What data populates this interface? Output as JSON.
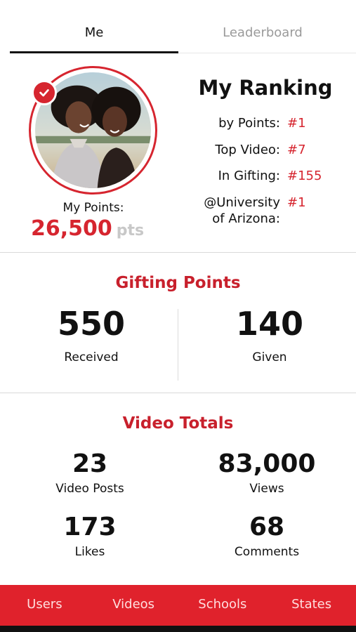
{
  "tabs": [
    {
      "label": "Me",
      "active": true
    },
    {
      "label": "Leaderboard",
      "active": false
    }
  ],
  "profile": {
    "points_label": "My Points:",
    "points_value": "26,500",
    "points_unit": "pts"
  },
  "ranking": {
    "title": "My Ranking",
    "rows": [
      {
        "label": "by Points:",
        "value": "#1"
      },
      {
        "label": "Top Video:",
        "value": "#7"
      },
      {
        "label": "In Gifting:",
        "value": "#155"
      },
      {
        "label": "@University of Arizona:",
        "label_line1": "@University",
        "label_line2": "of Arizona:",
        "value": "#1"
      }
    ]
  },
  "gifting": {
    "title": "Gifting Points",
    "received_value": "550",
    "received_label": "Received",
    "given_value": "140",
    "given_label": "Given"
  },
  "video_totals": {
    "title": "Video Totals",
    "stats": [
      {
        "value": "23",
        "label": "Video Posts"
      },
      {
        "value": "83,000",
        "label": "Views"
      },
      {
        "value": "173",
        "label": "Likes"
      },
      {
        "value": "68",
        "label": "Comments"
      }
    ]
  },
  "bottom_nav": [
    "Users",
    "Videos",
    "Schools",
    "States"
  ],
  "colors": {
    "accent": "#d6252f",
    "nav_background": "#e0222c",
    "points_unit": "#c8c8c8"
  },
  "icons": {
    "verified": "verified-check-icon",
    "avatar": "profile-photo"
  }
}
